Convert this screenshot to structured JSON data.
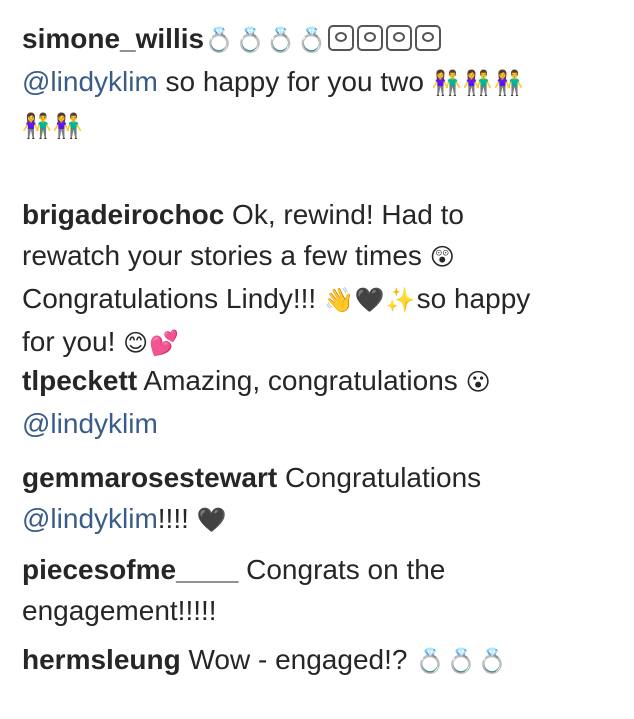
{
  "comments": [
    {
      "username": "simone_willis",
      "parts": [
        {
          "t": "emoji",
          "v": "💍💍💍💍"
        },
        {
          "t": "faces",
          "n": 4
        },
        {
          "t": "br"
        },
        {
          "t": "mention",
          "v": "@lindyklim"
        },
        {
          "t": "text",
          "v": " so happy for you two "
        },
        {
          "t": "emoji",
          "v": "👫👫👫"
        },
        {
          "t": "br"
        },
        {
          "t": "emoji",
          "v": "👫👫"
        }
      ]
    },
    {
      "username": "brigadeirochoc",
      "parts": [
        {
          "t": "text",
          "v": " Ok, rewind! Had to"
        },
        {
          "t": "br"
        },
        {
          "t": "text",
          "v": "rewatch your stories a few times "
        },
        {
          "t": "emoji",
          "v": "😲"
        },
        {
          "t": "br"
        },
        {
          "t": "text",
          "v": "Congratulations Lindy!!! "
        },
        {
          "t": "emoji",
          "v": "👋🖤✨"
        },
        {
          "t": "text",
          "v": "so happy"
        },
        {
          "t": "br"
        },
        {
          "t": "text",
          "v": "for you! "
        },
        {
          "t": "emoji",
          "v": "😊💕"
        }
      ]
    },
    {
      "username": "tlpeckett",
      "parts": [
        {
          "t": "text",
          "v": " Amazing, congratulations "
        },
        {
          "t": "emoji",
          "v": "😮"
        },
        {
          "t": "br"
        },
        {
          "t": "mention",
          "v": "@lindyklim"
        }
      ]
    },
    {
      "username": "gemmarosestewart",
      "parts": [
        {
          "t": "text",
          "v": " Congratulations"
        },
        {
          "t": "br"
        },
        {
          "t": "mention",
          "v": "@lindyklim"
        },
        {
          "t": "text",
          "v": "!!!! "
        },
        {
          "t": "emoji",
          "v": "🖤"
        }
      ]
    },
    {
      "username": "piecesofme____",
      "parts": [
        {
          "t": "text",
          "v": " Congrats on the"
        },
        {
          "t": "br"
        },
        {
          "t": "text",
          "v": "engagement!!!!!"
        }
      ]
    },
    {
      "username": "hermsleung",
      "parts": [
        {
          "t": "text",
          "v": " Wow - engaged!? "
        },
        {
          "t": "emoji",
          "v": "💍💍💍"
        }
      ]
    }
  ]
}
